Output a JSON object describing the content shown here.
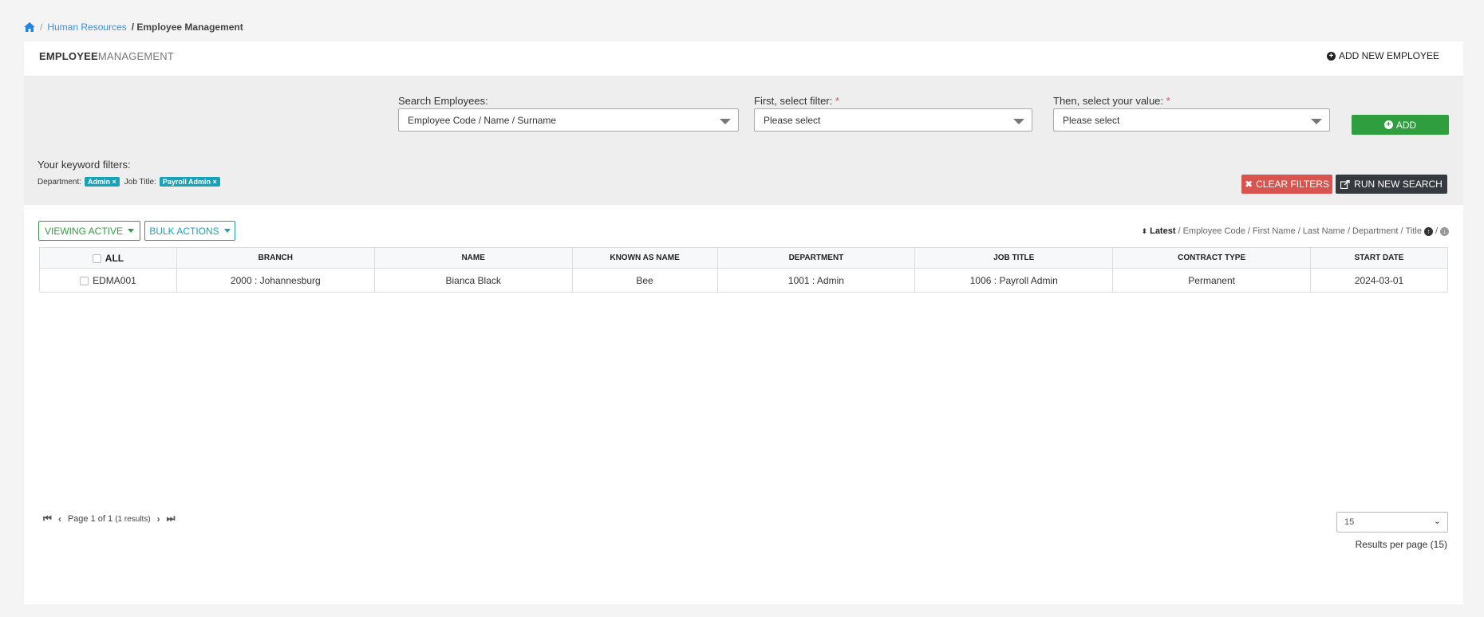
{
  "breadcrumb": {
    "home_icon": "home-icon",
    "sep": "/",
    "level1": "Human Resources",
    "current": "/ Employee Management"
  },
  "header": {
    "title_bold": "EMPLOYEE",
    "title_light": "MANAGEMENT",
    "add_label": "ADD NEW EMPLOYEE"
  },
  "search": {
    "search_label": "Search Employees:",
    "search_value": "Employee Code / Name / Surname",
    "filter_label": "First, select filter:",
    "filter_value": "Please select",
    "value_label": "Then, select your value:",
    "value_value": "Please select",
    "required_mark": "*",
    "add_label": "ADD",
    "keyword_title": "Your keyword filters:",
    "kw_dept_label": "Department:",
    "kw_dept_tag": "Admin ×",
    "kw_job_label": "Job Title:",
    "kw_job_tag": "Payroll Admin ×",
    "clear_label": "CLEAR FILTERS",
    "run_label": "RUN NEW SEARCH"
  },
  "toolbar": {
    "viewing_label": "VIEWING ACTIVE",
    "bulk_label": "BULK ACTIONS"
  },
  "sort": {
    "active": "Latest",
    "options": [
      "Employee Code",
      "First Name",
      "Last Name",
      "Department",
      "Title"
    ],
    "sep": "/"
  },
  "table": {
    "headers": [
      "ALL",
      "BRANCH",
      "NAME",
      "KNOWN AS NAME",
      "DEPARTMENT",
      "JOB TITLE",
      "CONTRACT TYPE",
      "START DATE"
    ],
    "rows": [
      [
        "EDMA001",
        "2000 : Johannesburg",
        "Bianca Black",
        "Bee",
        "1001 : Admin",
        "1006 : Payroll Admin",
        "Permanent",
        "2024-03-01"
      ]
    ]
  },
  "pagination": {
    "page_word": "Page",
    "current": "1",
    "of_word": "of",
    "total": "1",
    "results": "(1 results)",
    "per_page_value": "15",
    "per_page_label": "Results per page (15)"
  },
  "colors": {
    "accent_blue": "#1e88e5",
    "green": "#2e9e3e",
    "teal": "#17a2b8",
    "red": "#d9534f",
    "dark": "#343a40"
  }
}
